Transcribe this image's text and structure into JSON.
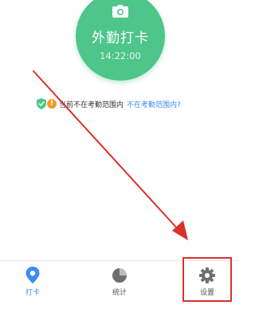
{
  "punch": {
    "label": "外勤打卡",
    "time": "14:22:00"
  },
  "location": {
    "status_text": "当前不在考勤范围内",
    "link_text": "不在考勤范围内?",
    "warning_glyph": "!"
  },
  "tabs": [
    {
      "label": "打卡",
      "icon": "location-pin-icon",
      "active": true
    },
    {
      "label": "统计",
      "icon": "pie-chart-icon",
      "active": false
    },
    {
      "label": "设置",
      "icon": "gear-icon",
      "active": false
    }
  ],
  "colors": {
    "punch_green": "#4ec58b",
    "accent_blue": "#3d8bf5",
    "warning_orange": "#f39c2d",
    "annotation_red": "#d9312b"
  }
}
